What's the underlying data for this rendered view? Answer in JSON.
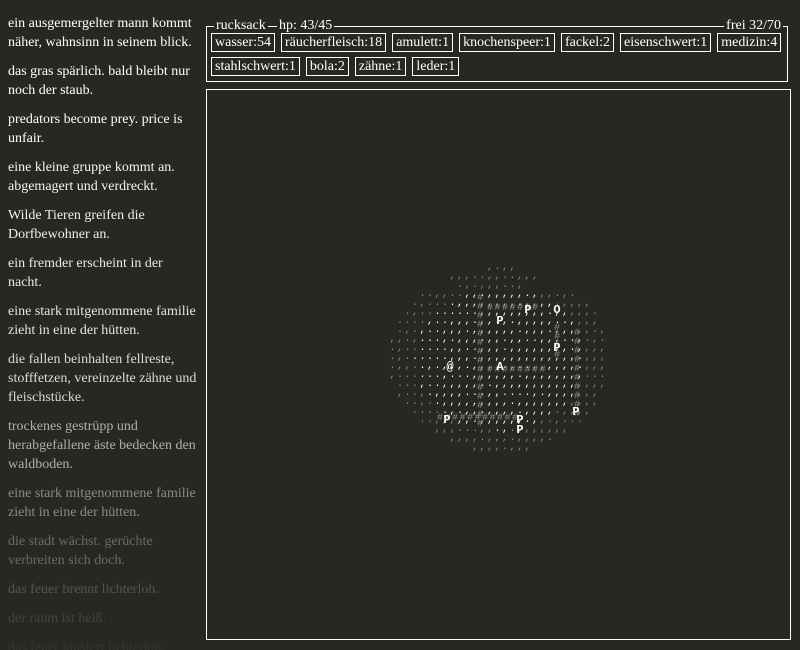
{
  "log": [
    {
      "text": "ein ausgemergelter mann kommt näher, wahnsinn in seinem blick.",
      "opacity": 1.0
    },
    {
      "text": "das gras spärlich. bald bleibt nur noch der staub.",
      "opacity": 1.0
    },
    {
      "text": "predators become prey. price is unfair.",
      "opacity": 1.0
    },
    {
      "text": "eine kleine gruppe kommt an. abgemagert und verdreckt.",
      "opacity": 0.95
    },
    {
      "text": "Wilde Tieren greifen die Dorfbewohner an.",
      "opacity": 0.92
    },
    {
      "text": "ein fremder erscheint in der nacht.",
      "opacity": 0.9
    },
    {
      "text": "eine stark mitgenommene familie zieht in eine der hütten.",
      "opacity": 0.88
    },
    {
      "text": "die fallen beinhalten fellreste, stofffetzen, vereinzelte zähne und fleischstücke.",
      "opacity": 0.82
    },
    {
      "text": "trockenes gestrüpp und herabgefallene äste bedecken den waldboden.",
      "opacity": 0.62
    },
    {
      "text": "eine stark mitgenommene familie zieht in eine der hütten.",
      "opacity": 0.45
    },
    {
      "text": "die stadt wächst. gerüchte verbreiten sich doch.",
      "opacity": 0.3
    },
    {
      "text": "das feuer brennt lichterloh.",
      "opacity": 0.2
    },
    {
      "text": "der raum ist heiß.",
      "opacity": 0.12
    },
    {
      "text": "das feuer knistert lichterloh.",
      "opacity": 0.06
    }
  ],
  "rucksack": {
    "title": "rucksack",
    "hp": "hp: 43/45",
    "free": "frei 32/70",
    "items": [
      "wasser:54",
      "räucherfleisch:18",
      "amulett:1",
      "knochenspeer:1",
      "fackel:2",
      "eisenschwert:1",
      "medizin:4",
      "stahlschwert:1",
      "bola:2",
      "zähne:1",
      "leder:1"
    ]
  },
  "map": {
    "symbols": [
      {
        "ch": "@",
        "kind": "player"
      },
      {
        "ch": "A",
        "kind": "landmark"
      },
      {
        "ch": "P",
        "kind": "landmark"
      },
      {
        "ch": "P",
        "kind": "landmark"
      },
      {
        "ch": "P",
        "kind": "landmark"
      },
      {
        "ch": "P",
        "kind": "landmark"
      },
      {
        "ch": "P",
        "kind": "landmark"
      },
      {
        "ch": "P",
        "kind": "landmark"
      },
      {
        "ch": "P",
        "kind": "landmark"
      },
      {
        "ch": "O",
        "kind": "landmark"
      }
    ],
    "colors": {
      "bright": "#ffffff",
      "dim": "#8a8a84",
      "faint": "#6e6e68"
    }
  }
}
